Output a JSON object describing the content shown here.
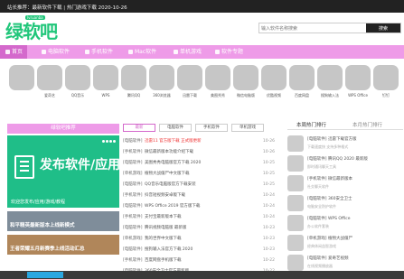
{
  "topbar": {
    "notice": "站长推荐：最新软件下载 | 热门游戏下载  2020-10-26"
  },
  "header": {
    "logo_text": "绿软吧",
    "logo_tag": "lvruanba",
    "search_placeholder": "输入软件名称搜索",
    "search_button": "搜索"
  },
  "nav": {
    "items": [
      {
        "label": "首页",
        "active": true
      },
      {
        "label": "电脑软件",
        "active": false
      },
      {
        "label": "手机软件",
        "active": false
      },
      {
        "label": "Mac软件",
        "active": false
      },
      {
        "label": "单机游戏",
        "active": false
      },
      {
        "label": "软件专题",
        "active": false
      }
    ]
  },
  "apps": [
    {
      "label": ""
    },
    {
      "label": "爱奇艺"
    },
    {
      "label": "QQ音乐"
    },
    {
      "label": "WPS"
    },
    {
      "label": "腾讯QQ"
    },
    {
      "label": "360浏览器"
    },
    {
      "label": "迅雷下载"
    },
    {
      "label": "美图秀秀"
    },
    {
      "label": "微信电脑版"
    },
    {
      "label": "优酷视频"
    },
    {
      "label": "百度网盘"
    },
    {
      "label": "搜狗输入法"
    },
    {
      "label": "WPS Office"
    },
    {
      "label": "钉钉"
    }
  ],
  "left": {
    "head": "绿软吧推荐",
    "slide_big": "发布软件/应用",
    "slide_caption": "欢迎您发布/应用/游戏/教程",
    "captions": [
      "和平精英最新版本上线新模式",
      "王者荣耀五月新赛季上线活动汇总"
    ],
    "colors": {
      "slide": "#1fbe88",
      "accent": "#ee9be8"
    }
  },
  "mid": {
    "tabs": [
      {
        "label": "最新",
        "active": true
      },
      {
        "label": "电脑软件",
        "active": false
      },
      {
        "label": "手机软件",
        "active": false
      },
      {
        "label": "单机游戏",
        "active": false
      }
    ],
    "rows": [
      {
        "cat": "[电脑软件]",
        "title": "迅雷11 官方版下载 正式版更新",
        "date": "10-26",
        "red": true
      },
      {
        "cat": "[手机软件]",
        "title": "微信最新版本功能介绍下载",
        "date": "10-26",
        "red": false
      },
      {
        "cat": "[电脑软件]",
        "title": "美图秀秀电脑版官方下载 2020",
        "date": "10-25",
        "red": false
      },
      {
        "cat": "[单机游戏]",
        "title": "植物大战僵尸中文版下载",
        "date": "10-25",
        "red": false
      },
      {
        "cat": "[电脑软件]",
        "title": "QQ音乐电脑版官方下载安装",
        "date": "10-25",
        "red": false
      },
      {
        "cat": "[手机软件]",
        "title": "抖音短视频安卓版下载",
        "date": "10-24",
        "red": false
      },
      {
        "cat": "[电脑软件]",
        "title": "WPS Office 2019 官方版下载",
        "date": "10-24",
        "red": false
      },
      {
        "cat": "[手机软件]",
        "title": "支付宝最新版本下载",
        "date": "10-24",
        "red": false
      },
      {
        "cat": "[电脑软件]",
        "title": "腾讯视频电脑版 最新版",
        "date": "10-23",
        "red": false
      },
      {
        "cat": "[单机游戏]",
        "title": "我的世界中文版下载",
        "date": "10-23",
        "red": false
      },
      {
        "cat": "[电脑软件]",
        "title": "搜狗输入法官方下载 2020",
        "date": "10-23",
        "red": false
      },
      {
        "cat": "[手机软件]",
        "title": "百度网盘手机版下载",
        "date": "10-22",
        "red": false
      },
      {
        "cat": "[电脑软件]",
        "title": "360安全卫士官方最新版",
        "date": "10-22",
        "red": false
      }
    ]
  },
  "right": {
    "tabs": [
      {
        "label": "本周热门排行"
      },
      {
        "label": "本月热门排行"
      }
    ],
    "items": [
      {
        "title": "[电脑软件] 迅雷下载官方版",
        "desc": "下载速度快 支持多种格式"
      },
      {
        "title": "[电脑软件] 腾讯QQ 2020 最新版",
        "desc": "即时通讯聊天工具"
      },
      {
        "title": "[手机软件] 微信最新版本",
        "desc": "社交聊天软件"
      },
      {
        "title": "[电脑软件] 360安全卫士",
        "desc": "电脑安全防护软件"
      },
      {
        "title": "[电脑软件] WPS Office",
        "desc": "办公软件套装"
      },
      {
        "title": "[单机游戏] 植物大战僵尸",
        "desc": "经典休闲益智游戏"
      },
      {
        "title": "[电脑软件] 爱奇艺视频",
        "desc": "在线视频播放器"
      }
    ]
  }
}
